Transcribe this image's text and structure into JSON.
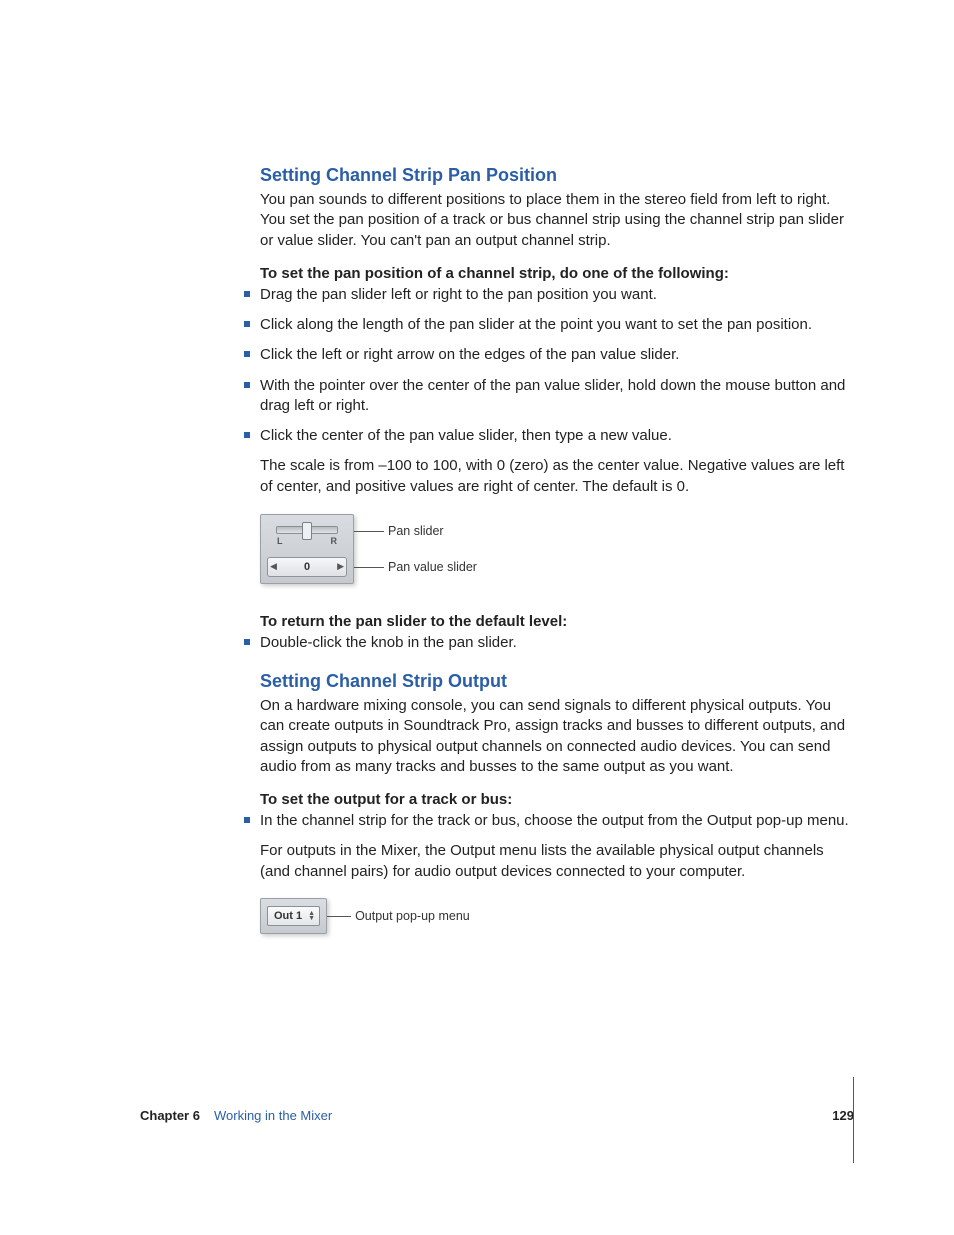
{
  "section1": {
    "heading": "Setting Channel Strip Pan Position",
    "para": "You pan sounds to different positions to place them in the stereo field from left to right. You set the pan position of a track or bus channel strip using the channel strip pan slider or value slider. You can't pan an output channel strip.",
    "leadin1": "To set the pan position of a channel strip, do one of the following:",
    "bullets": [
      "Drag the pan slider left or right to the pan position you want.",
      "Click along the length of the pan slider at the point you want to set the pan position.",
      "Click the left or right arrow on the edges of the pan value slider.",
      "With the pointer over the center of the pan value slider, hold down the mouse button and drag left or right.",
      "Click the center of the pan value slider, then type a new value."
    ],
    "trail": "The scale is from –100 to 100, with 0 (zero) as the center value. Negative values are left of center, and positive values are right of center. The default is 0.",
    "fig": {
      "L": "L",
      "R": "R",
      "value": "0",
      "callout_slider": "Pan slider",
      "callout_value": "Pan value slider"
    },
    "leadin2": "To return the pan slider to the default level:",
    "bullets2": [
      "Double-click the knob in the pan slider."
    ]
  },
  "section2": {
    "heading": "Setting Channel Strip Output",
    "para": "On a hardware mixing console, you can send signals to different physical outputs. You can create outputs in Soundtrack Pro, assign tracks and busses to different outputs, and assign outputs to physical output channels on connected audio devices. You can send audio from as many tracks and busses to the same output as you want.",
    "leadin": "To set the output for a track or bus:",
    "bullets": [
      "In the channel strip for the track or bus, choose the output from the Output pop-up menu."
    ],
    "trail": "For outputs in the Mixer, the Output menu lists the available physical output channels (and channel pairs) for audio output devices connected to your computer.",
    "fig": {
      "label": "Out 1",
      "callout": "Output pop-up menu"
    }
  },
  "footer": {
    "chapter": "Chapter 6",
    "title": "Working in the Mixer",
    "page": "129"
  }
}
